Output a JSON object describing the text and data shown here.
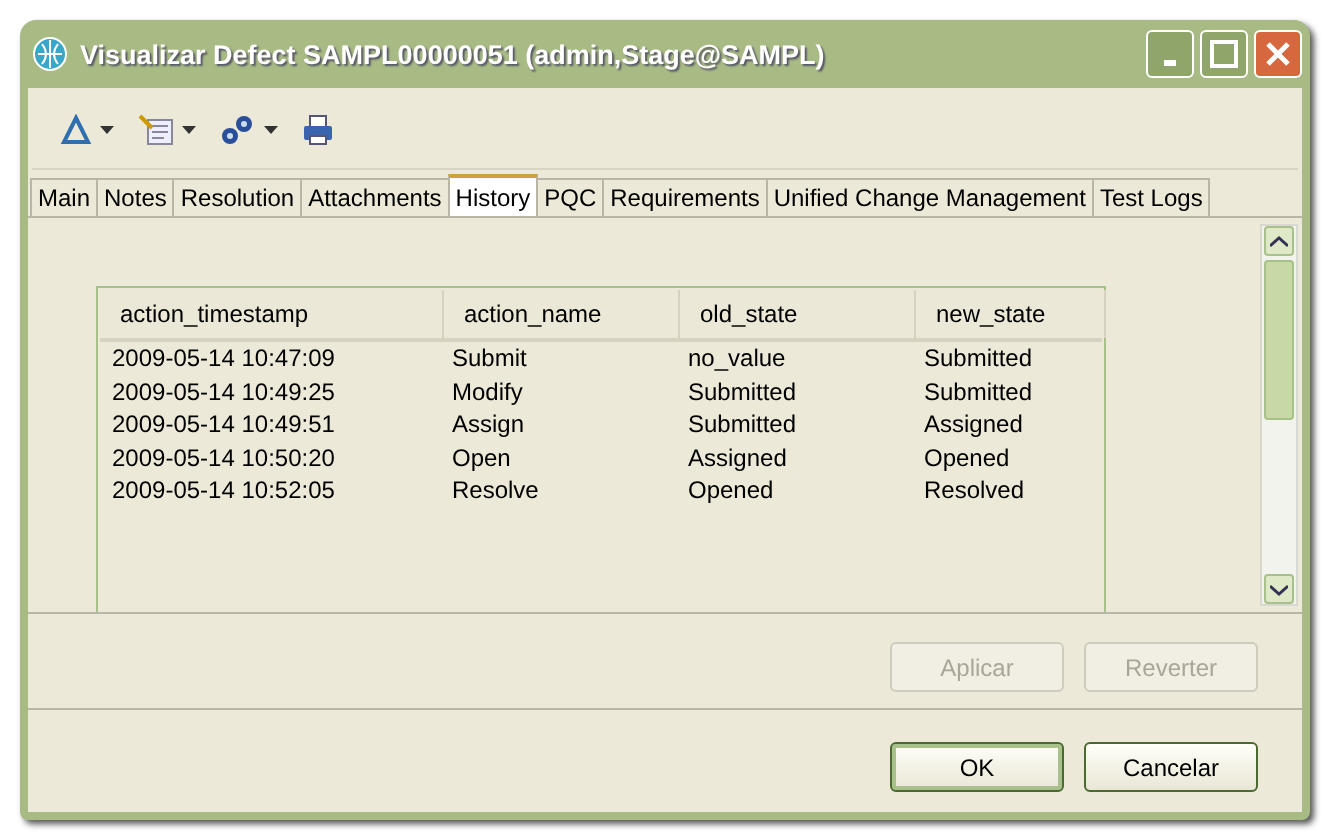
{
  "window": {
    "title": "Visualizar Defect SAMPL00000051 (admin,Stage@SAMPL)"
  },
  "tabs": [
    {
      "label": "Main",
      "selected": false
    },
    {
      "label": "Notes",
      "selected": false
    },
    {
      "label": "Resolution",
      "selected": false
    },
    {
      "label": "Attachments",
      "selected": false
    },
    {
      "label": "History",
      "selected": true
    },
    {
      "label": "PQC",
      "selected": false
    },
    {
      "label": "Requirements",
      "selected": false
    },
    {
      "label": "Unified Change Management",
      "selected": false
    },
    {
      "label": "Test Logs",
      "selected": false
    }
  ],
  "table": {
    "columns": [
      "action_timestamp",
      "action_name",
      "old_state",
      "new_state"
    ],
    "rows": [
      [
        "2009-05-14 10:47:09",
        "Submit",
        "no_value",
        "Submitted"
      ],
      [
        "2009-05-14 10:49:25",
        "Modify",
        "Submitted",
        "Submitted"
      ],
      [
        "2009-05-14 10:49:51",
        "Assign",
        "Submitted",
        "Assigned"
      ],
      [
        "2009-05-14 10:50:20",
        "Open",
        "Assigned",
        "Opened"
      ],
      [
        "2009-05-14 10:52:05",
        "Resolve",
        "Opened",
        "Resolved"
      ]
    ]
  },
  "apply_buttons": [
    {
      "label": "Aplicar",
      "disabled": true
    },
    {
      "label": "Reverter",
      "disabled": true
    }
  ],
  "dialog_buttons": [
    {
      "label": "OK",
      "default": true
    },
    {
      "label": "Cancelar",
      "default": false
    }
  ]
}
